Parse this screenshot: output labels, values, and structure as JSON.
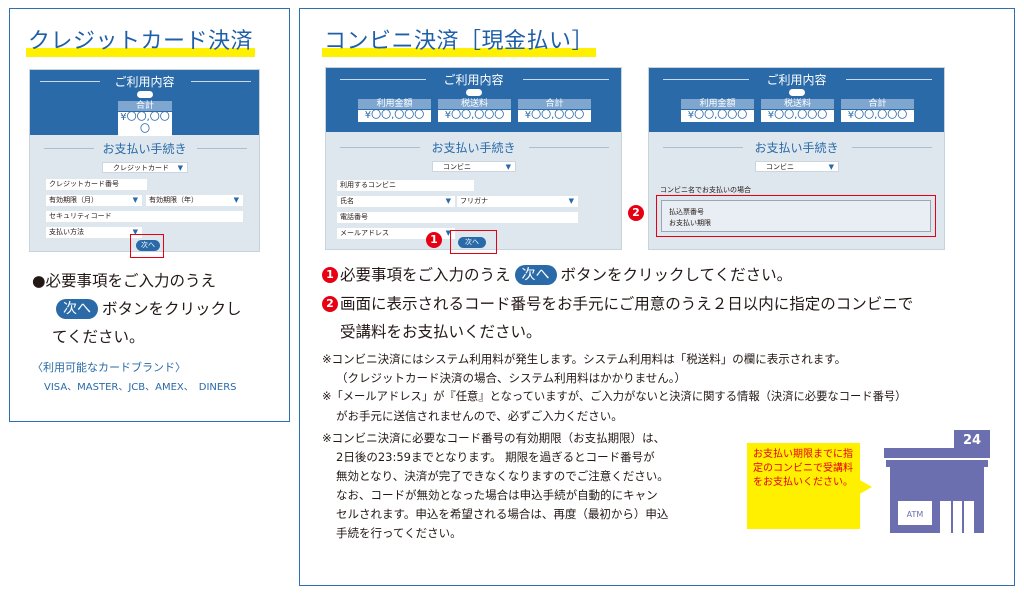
{
  "credit": {
    "title": "クレジットカード決済",
    "mock": {
      "usage_title": "ご利用内容",
      "total_label": "合計",
      "total_value": "¥〇〇,〇〇〇",
      "procedure_title": "お支払い手続き",
      "method_value": "クレジットカード",
      "card_number": "クレジットカード番号",
      "exp_month": "有効期限（月）",
      "exp_year": "有効期限（年）",
      "security_code": "セキュリティコード",
      "payment_method": "支払い方法",
      "next": "次へ"
    },
    "instruction_1": "●必要事項をご入力のうえ",
    "instruction_2": "ボタンをクリックし",
    "instruction_3": "てください。",
    "next_button": "次へ",
    "brands_heading": "〈利用可能なカードブランド〉",
    "brands_list": "VISA、MASTER、JCB、AMEX、　DINERS"
  },
  "conv": {
    "title": "コンビニ決済［現金払い］",
    "mock1": {
      "usage_title": "ご利用内容",
      "col1_label": "利用金額",
      "col2_label": "税送料",
      "col3_label": "合計",
      "value": "¥〇〇,〇〇〇",
      "procedure_title": "お支払い手続き",
      "method_value": "コンビニ",
      "store_label": "利用するコンビニ",
      "name_label": "氏名",
      "furigana_label": "フリガナ",
      "phone_label": "電話番号",
      "email_label": "メールアドレス",
      "next": "次へ"
    },
    "mock2": {
      "usage_title": "ご利用内容",
      "col1_label": "利用金額",
      "col2_label": "税送料",
      "col3_label": "合計",
      "value": "¥〇〇,〇〇〇",
      "procedure_title": "お支払い手続き",
      "method_value": "コンビニ",
      "store_payment_label": "コンビニ名でお支払いの場合",
      "ticket_number": "払込票番号",
      "payment_deadline": "お支払い期限"
    },
    "marker1": "1",
    "marker2": "2",
    "step1_pre": "必要事項をご入力のうえ",
    "step1_btn": "次へ",
    "step1_post": "ボタンをクリックしてください。",
    "step2_line1": "画面に表示されるコード番号をお手元にご用意のうえ２日以内に指定のコンビニで",
    "step2_line2": "受講料をお支払いください。",
    "notes": [
      "※コンビニ決済にはシステム利用料が発生します。システム利用料は「税送料」の欄に表示されます。",
      "（クレジットカード決済の場合、システム利用料はかかりません。）",
      "※「メールアドレス」が『任意』となっていますが、ご入力がないと決済に関する情報（決済に必要なコード番号）",
      "がお手元に送信されませんので、必ずご入力ください。",
      "※コンビニ決済に必要なコード番号の有効期限（お支払期限）は、",
      "2日後の23:59までとなります。 期限を過ぎるとコード番号が",
      "無効となり、決済が完了できなくなりますのでご注意ください。",
      "なお、コードが無効となった場合は申込手続が自動的にキャン",
      "セルされます。申込を希望される場合は、再度（最初から）申込",
      "手続を行ってください。"
    ],
    "callout": "お支払い期限までに指定のコンビニで受講料をお支払いください。",
    "store_sign": "24",
    "atm_label": "ATM",
    "colors": {
      "accent": "#2a6aa8",
      "highlight": "#fff000",
      "alert": "#e60012",
      "store": "#6b6fb0"
    }
  }
}
